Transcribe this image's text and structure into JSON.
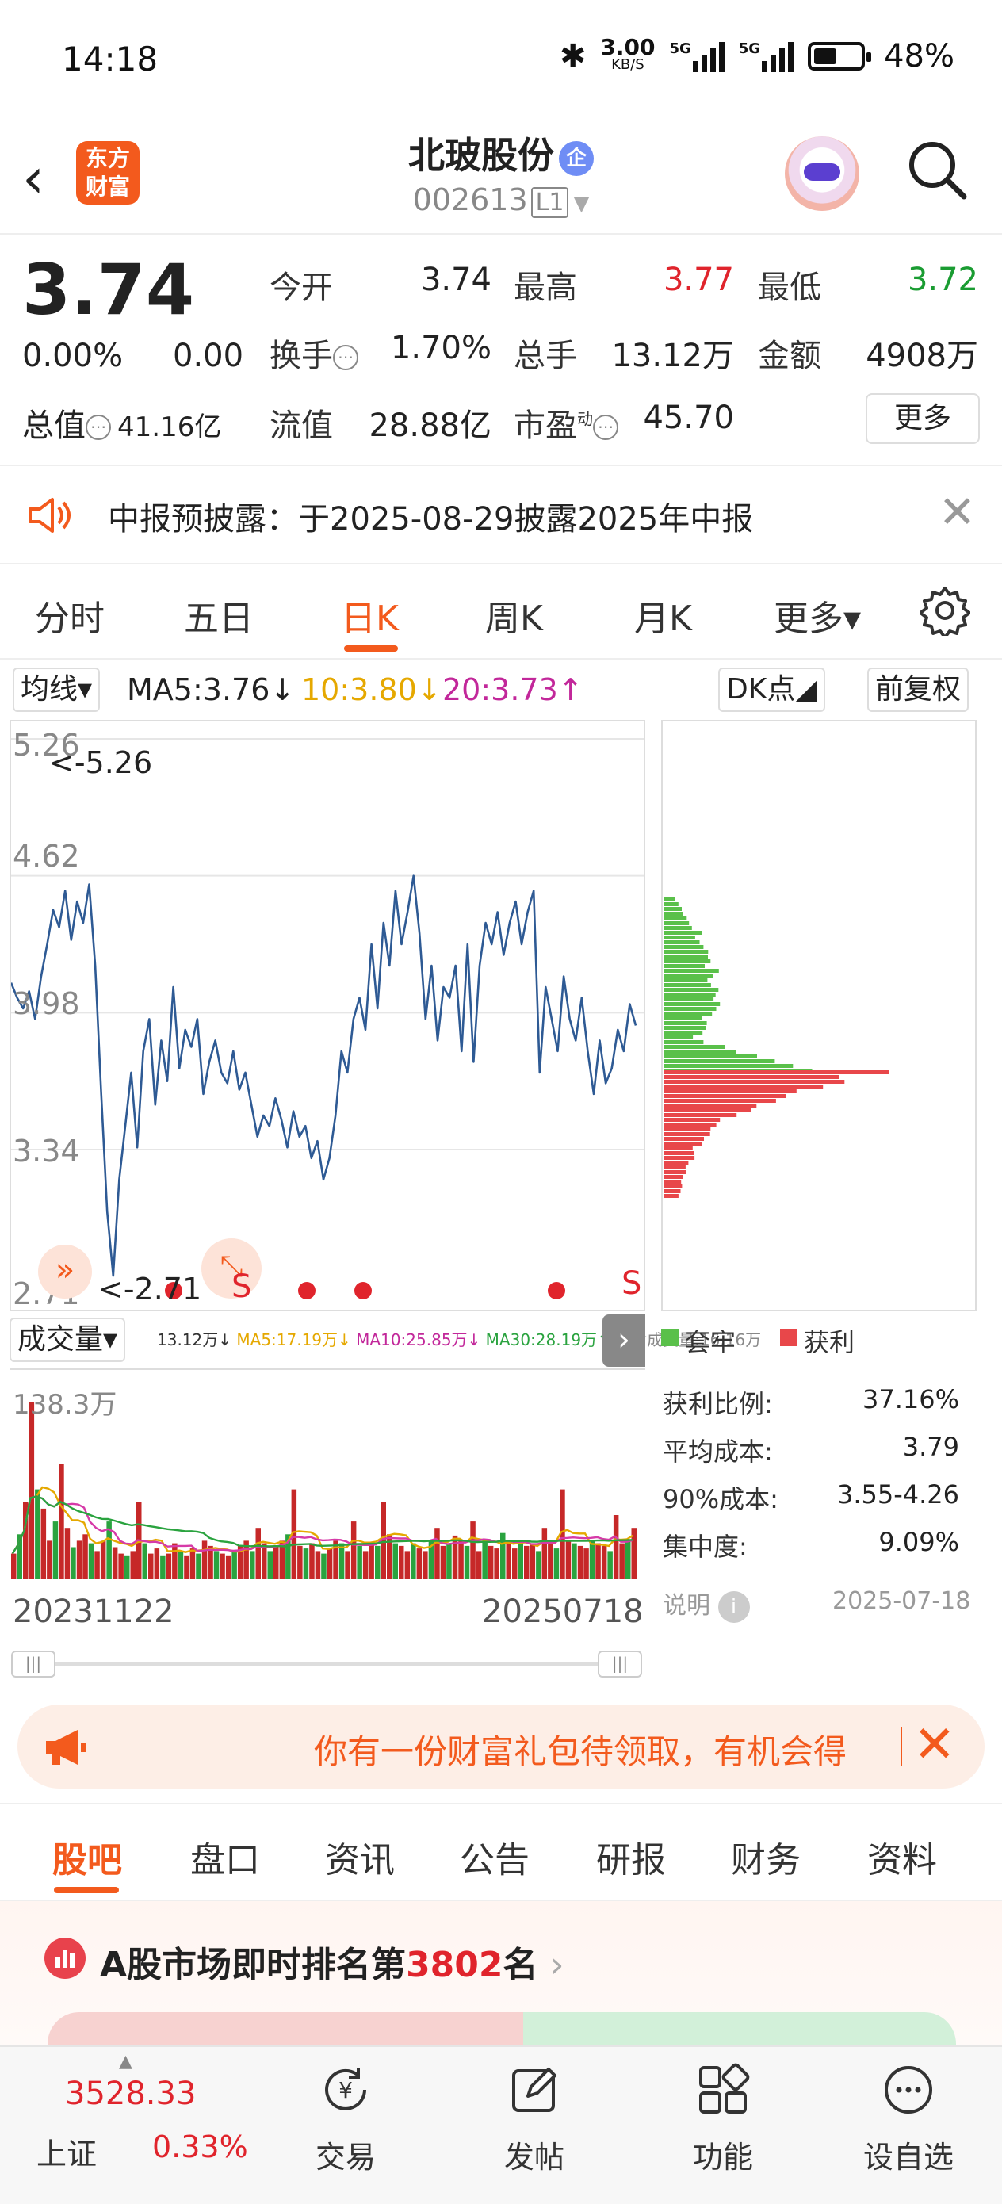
{
  "status": {
    "time": "14:18",
    "net_speed": "3.00",
    "net_unit": "KB/S",
    "net1": "5G",
    "net2": "5G",
    "battery": "48%"
  },
  "header": {
    "stock_name": "北玻股份",
    "badge": "企",
    "stock_code": "002613",
    "level": "L1",
    "logo_line1": "东方",
    "logo_line2": "财富"
  },
  "quote": {
    "price": "3.74",
    "change_pct": "0.00%",
    "change": "0.00",
    "open_label": "今开",
    "open": "3.74",
    "high_label": "最高",
    "high": "3.77",
    "low_label": "最低",
    "low": "3.72",
    "turnover_label": "换手",
    "turnover": "1.70%",
    "volume_label": "总手",
    "volume": "13.12万",
    "amount_label": "金额",
    "amount": "4908万",
    "total_mv_label": "总值",
    "total_mv": "41.16亿",
    "float_mv_label": "流值",
    "float_mv": "28.88亿",
    "pe_label": "市盈",
    "pe_sup": "动",
    "pe": "45.70",
    "more_label": "更多"
  },
  "notice": {
    "text": "中报预披露：于2025-08-29披露2025年中报"
  },
  "chart_tabs": [
    "分时",
    "五日",
    "日K",
    "周K",
    "月K",
    "更多▾"
  ],
  "active_chart_tab": 2,
  "ma": {
    "selector": "均线▾",
    "ma5": "MA5:3.76↓",
    "ma10": "10:3.80↓",
    "ma20": "20:3.73↑",
    "dk": "DK点◢",
    "adjust": "前复权",
    "ma10_color": "#e5a800",
    "ma20_color": "#c2279a"
  },
  "chart_data": {
    "type": "line",
    "y_ticks": [
      "5.26",
      "4.62",
      "3.98",
      "3.34",
      "2.71"
    ],
    "ylim": [
      2.71,
      5.26
    ],
    "max_marker": "<-5.26",
    "min_marker": "<-2.71",
    "signal_labels": [
      "S",
      "S"
    ],
    "close": [
      4.12,
      4.05,
      4.0,
      4.08,
      3.95,
      4.15,
      4.3,
      4.46,
      4.38,
      4.55,
      4.32,
      4.5,
      4.4,
      4.58,
      4.2,
      3.6,
      3.05,
      2.75,
      3.2,
      3.45,
      3.7,
      3.35,
      3.8,
      3.95,
      3.55,
      3.85,
      3.66,
      4.1,
      3.72,
      3.9,
      3.82,
      3.95,
      3.6,
      3.75,
      3.85,
      3.7,
      3.65,
      3.8,
      3.62,
      3.7,
      3.55,
      3.4,
      3.5,
      3.45,
      3.58,
      3.48,
      3.35,
      3.52,
      3.4,
      3.45,
      3.3,
      3.38,
      3.2,
      3.3,
      3.5,
      3.8,
      3.7,
      3.95,
      4.05,
      3.9,
      4.3,
      4.0,
      4.4,
      4.2,
      4.55,
      4.3,
      4.45,
      4.62,
      4.35,
      3.95,
      4.2,
      3.85,
      4.1,
      4.05,
      4.2,
      3.8,
      4.3,
      3.75,
      4.2,
      4.4,
      4.3,
      4.45,
      4.25,
      4.4,
      4.5,
      4.3,
      4.45,
      4.55,
      3.7,
      4.1,
      3.95,
      3.8,
      4.15,
      3.95,
      3.85,
      4.05,
      3.8,
      3.6,
      3.85,
      3.65,
      3.72,
      3.9,
      3.8,
      4.02,
      3.92
    ],
    "volume_series": [
      {
        "name": "MA5",
        "color": "#e5a800"
      },
      {
        "name": "MA10",
        "color": "#d63aa8"
      },
      {
        "name": "MA30",
        "color": "#2aa33f"
      }
    ]
  },
  "volume": {
    "selector": "成交量▾",
    "legend": [
      {
        "text": "13.12万↓",
        "color": "#333333"
      },
      {
        "text": "MA5:17.19万↓",
        "color": "#e5a800"
      },
      {
        "text": "MA10:25.85万↓",
        "color": "#c2279a"
      },
      {
        "text": "MA30:28.19万↑",
        "color": "#2aa33f"
      },
      {
        "text": "盘后成交量:16.16万",
        "color": "#888888"
      }
    ],
    "max_label": "138.3万",
    "values": [
      20,
      35,
      60,
      138,
      70,
      55,
      30,
      45,
      90,
      40,
      25,
      30,
      35,
      28,
      22,
      30,
      45,
      25,
      20,
      18,
      22,
      60,
      28,
      20,
      24,
      18,
      20,
      28,
      22,
      18,
      24,
      20,
      30,
      26,
      22,
      20,
      18,
      22,
      26,
      30,
      22,
      40,
      28,
      22,
      26,
      30,
      35,
      70,
      26,
      24,
      28,
      22,
      20,
      24,
      30,
      28,
      22,
      45,
      26,
      22,
      28,
      26,
      60,
      35,
      28,
      26,
      22,
      28,
      24,
      22,
      30,
      40,
      26,
      28,
      34,
      30,
      26,
      45,
      22,
      30,
      26,
      24,
      36,
      28,
      24,
      30,
      26,
      28,
      22,
      40,
      28,
      24,
      70,
      30,
      28,
      26,
      24,
      30,
      28,
      26,
      22,
      50,
      28,
      30,
      40
    ]
  },
  "dates": {
    "start": "20231122",
    "end": "20250718"
  },
  "chip": {
    "legend_trapped": "套牢",
    "legend_profit": "获利",
    "trapped_color": "#5ac04a",
    "profit_color": "#e8474a",
    "rows": [
      {
        "label": "获利比例:",
        "value": "37.16%"
      },
      {
        "label": "平均成本:",
        "value": "3.79"
      },
      {
        "label": "90%成本:",
        "value": "3.55-4.26"
      },
      {
        "label": "集中度:",
        "value": "9.09%"
      }
    ],
    "note_label": "说明",
    "date": "2025-07-18"
  },
  "promo": {
    "text": "你有一份财富礼包待领取，有机会得"
  },
  "bottom_tabs": [
    "股吧",
    "盘口",
    "资讯",
    "公告",
    "研报",
    "财务",
    "资料"
  ],
  "ranking": {
    "prefix": "A股市场即时排名第",
    "rank": "3802",
    "suffix": "名",
    "arrow": "›"
  },
  "index": {
    "value": "3528.33",
    "name": "上证",
    "pct": "0.33%"
  },
  "nav": [
    "交易",
    "发帖",
    "功能",
    "设自选"
  ]
}
